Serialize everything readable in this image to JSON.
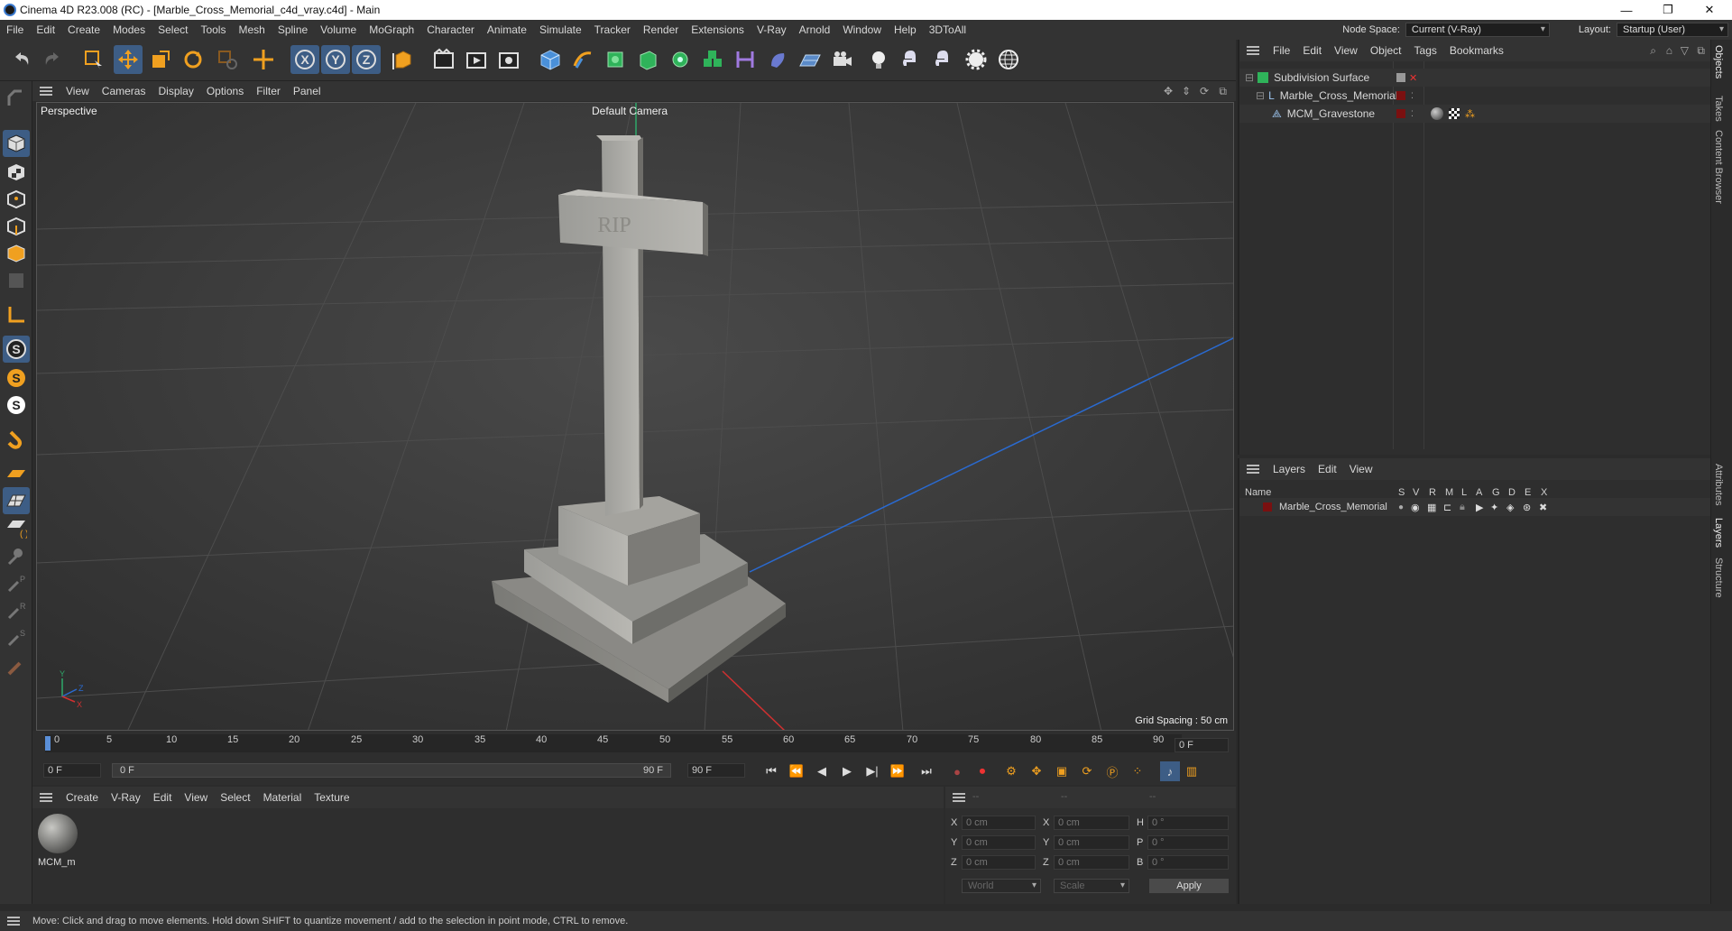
{
  "window": {
    "title": "Cinema 4D R23.008 (RC) - [Marble_Cross_Memorial_c4d_vray.c4d] - Main",
    "minimize": "—",
    "maximize": "❐",
    "close": "✕"
  },
  "menubar": {
    "items": [
      "File",
      "Edit",
      "Create",
      "Modes",
      "Select",
      "Tools",
      "Mesh",
      "Spline",
      "Volume",
      "MoGraph",
      "Character",
      "Animate",
      "Simulate",
      "Tracker",
      "Render",
      "Extensions",
      "V-Ray",
      "Arnold",
      "Window",
      "Help",
      "3DToAll"
    ],
    "node_space_label": "Node Space:",
    "node_space_value": "Current (V-Ray)",
    "layout_label": "Layout:",
    "layout_value": "Startup (User)"
  },
  "viewport": {
    "menu": [
      "View",
      "Cameras",
      "Display",
      "Options",
      "Filter",
      "Panel"
    ],
    "label": "Perspective",
    "camera": "Default Camera",
    "grid_spacing": "Grid Spacing : 50 cm",
    "cross_text": "RIP",
    "axis_y": "Y",
    "axis_z": "Z",
    "axis_x": "X"
  },
  "timeline": {
    "ticks": [
      "0",
      "5",
      "10",
      "15",
      "20",
      "25",
      "30",
      "35",
      "40",
      "45",
      "50",
      "55",
      "60",
      "65",
      "70",
      "75",
      "80",
      "85",
      "90"
    ],
    "current_frame": "0 F",
    "start_frame": "0 F",
    "range_start": "0 F",
    "range_end": "90 F",
    "end_frame": "90 F",
    "end_frame2": "90 F"
  },
  "material_manager": {
    "menu": [
      "Create",
      "V-Ray",
      "Edit",
      "View",
      "Select",
      "Material",
      "Texture"
    ],
    "material_name": "MCM_m"
  },
  "coordinates": {
    "headers": [
      "--",
      "--",
      "--"
    ],
    "rows": [
      {
        "axis": "X",
        "pos": "0 cm",
        "axis2": "X",
        "size": "0 cm",
        "axis3": "H",
        "rot": "0 °"
      },
      {
        "axis": "Y",
        "pos": "0 cm",
        "axis2": "Y",
        "size": "0 cm",
        "axis3": "P",
        "rot": "0 °"
      },
      {
        "axis": "Z",
        "pos": "0 cm",
        "axis2": "Z",
        "size": "0 cm",
        "axis3": "B",
        "rot": "0 °"
      }
    ],
    "space": "World",
    "mode": "Scale",
    "apply": "Apply"
  },
  "object_manager": {
    "menu": [
      "File",
      "Edit",
      "View",
      "Object",
      "Tags",
      "Bookmarks"
    ],
    "objects": [
      {
        "name": "Subdivision Surface"
      },
      {
        "name": "Marble_Cross_Memorial"
      },
      {
        "name": "MCM_Gravestone"
      }
    ]
  },
  "layer_manager": {
    "menu": [
      "Layers",
      "Edit",
      "View"
    ],
    "name_header": "Name",
    "cols": [
      "S",
      "V",
      "R",
      "M",
      "L",
      "A",
      "G",
      "D",
      "E",
      "X"
    ],
    "layer_name": "Marble_Cross_Memorial",
    "layer_color": "#7a1010"
  },
  "side_tabs": [
    "Objects",
    "Takes",
    "Content Browser",
    "Attributes",
    "Layers",
    "Structure"
  ],
  "status": "Move: Click and drag to move elements. Hold down SHIFT to quantize movement / add to the selection in point mode, CTRL to remove."
}
